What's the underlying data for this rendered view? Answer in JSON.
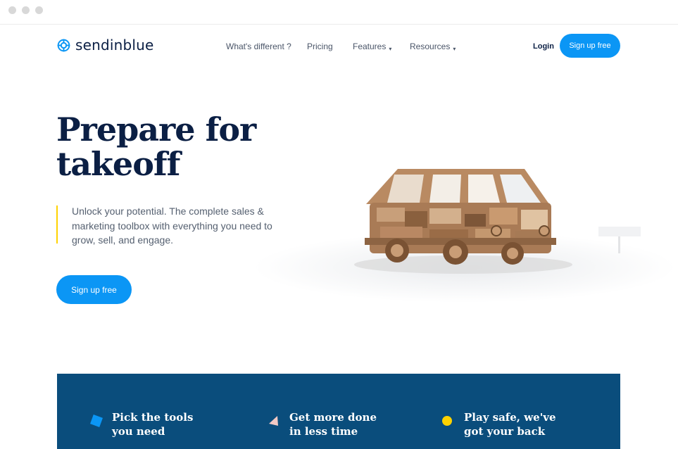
{
  "brand": {
    "name": "sendinblue",
    "icon": "sendinblue-logo-icon",
    "color": "#0b96f5"
  },
  "nav": {
    "items": [
      {
        "label": "What's different ?"
      },
      {
        "label": "Pricing"
      },
      {
        "label": "Features",
        "caret": "▾"
      },
      {
        "label": "Resources",
        "caret": "▾"
      }
    ],
    "login": "Login",
    "signup": "Sign up free"
  },
  "hero": {
    "title_line1": "Prepare for",
    "title_line2": "takeoff",
    "description": "Unlock your potential. The complete sales & marketing toolbox with everything you need to grow, sell, and engage.",
    "cta": "Sign up free",
    "image": "wooden-van-image"
  },
  "features": [
    {
      "line1": "Pick the tools",
      "line2": "you need",
      "icon": "blue-diamond-icon",
      "color": "#0b96f5"
    },
    {
      "line1": "Get more done",
      "line2": "in less time",
      "icon": "pink-triangle-icon",
      "color": "#f2c9c4"
    },
    {
      "line1": "Play safe, we've",
      "line2": "got your back",
      "icon": "yellow-circle-icon",
      "color": "#ffd200"
    }
  ],
  "colors": {
    "primary": "#0b96f5",
    "navy": "#0b1f44",
    "band": "#0a4d7c",
    "accent": "#ffd200"
  }
}
